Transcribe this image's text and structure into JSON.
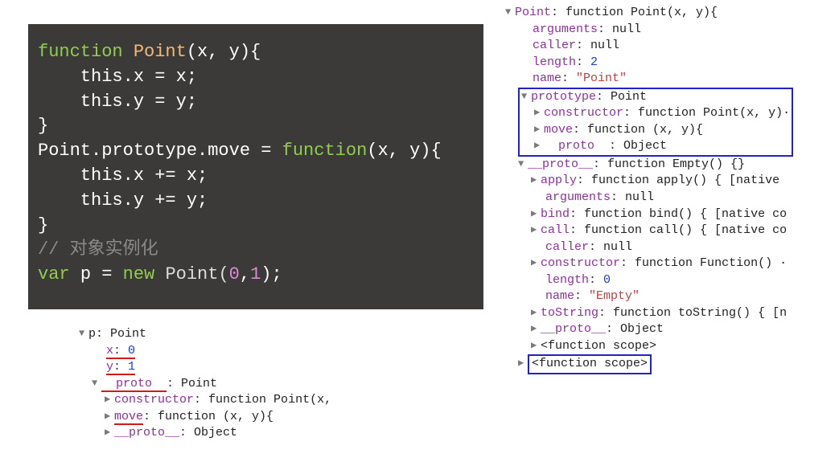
{
  "code": {
    "line1a": "function ",
    "line1b": "Point",
    "line1c": "(x, y){",
    "line2": "    this.x = x;",
    "line3": "    this.y = y;",
    "line4": "}",
    "line5a": "Point.prototype.move = ",
    "line5b": "function",
    "line5c": "(x, y){",
    "line6": "    this.x += x;",
    "line7": "    this.y += y;",
    "line8": "}",
    "line9": "// 对象实例化",
    "line10a": "var ",
    "line10b": "p = ",
    "line10c": "new ",
    "line10d": "Point(",
    "line10e": "0",
    "line10f": ",",
    "line10g": "1",
    "line10h": ");"
  },
  "leftTree": {
    "root": "p: Point",
    "x": {
      "k": "x",
      "v": "0"
    },
    "y": {
      "k": "y",
      "v": "1"
    },
    "proto": {
      "k": "  proto  ",
      "v": "Point"
    },
    "ctor": {
      "k": "constructor",
      "v": "function Point(x,"
    },
    "move": {
      "k": "move",
      "v": "function (x, y){"
    },
    "dunder": {
      "k": "__proto__",
      "v": "Object"
    }
  },
  "rightTree": {
    "root": {
      "k": "Point",
      "v": "function Point(x, y){"
    },
    "args": {
      "k": "arguments",
      "v": "null"
    },
    "caller": {
      "k": "caller",
      "v": "null"
    },
    "length": {
      "k": "length",
      "v": "2"
    },
    "name": {
      "k": "name",
      "v": "\"Point\""
    },
    "prototype": {
      "k": "prototype",
      "v": "Point"
    },
    "proto_ctor": {
      "k": "constructor",
      "v": "function Point(x, y)·"
    },
    "proto_move": {
      "k": "move",
      "v": "function (x, y){"
    },
    "proto_dunder": {
      "k": "  proto  ",
      "v": "Object"
    },
    "dproto": {
      "k": "__proto__",
      "v": "function Empty() {}"
    },
    "apply": {
      "k": "apply",
      "v": "function apply() { [native"
    },
    "args2": {
      "k": "arguments",
      "v": "null"
    },
    "bind": {
      "k": "bind",
      "v": "function bind() { [native co"
    },
    "call": {
      "k": "call",
      "v": "function call() { [native co"
    },
    "caller2": {
      "k": "caller",
      "v": "null"
    },
    "ctor2": {
      "k": "constructor",
      "v": "function Function() ·"
    },
    "length2": {
      "k": "length",
      "v": "0"
    },
    "name2": {
      "k": "name",
      "v": "\"Empty\""
    },
    "tostring": {
      "k": "toString",
      "v": "function toString() { [n"
    },
    "dunder2": {
      "k": "__proto__",
      "v": "Object"
    },
    "scope1": "<function scope>",
    "scope2": "<function scope>"
  }
}
